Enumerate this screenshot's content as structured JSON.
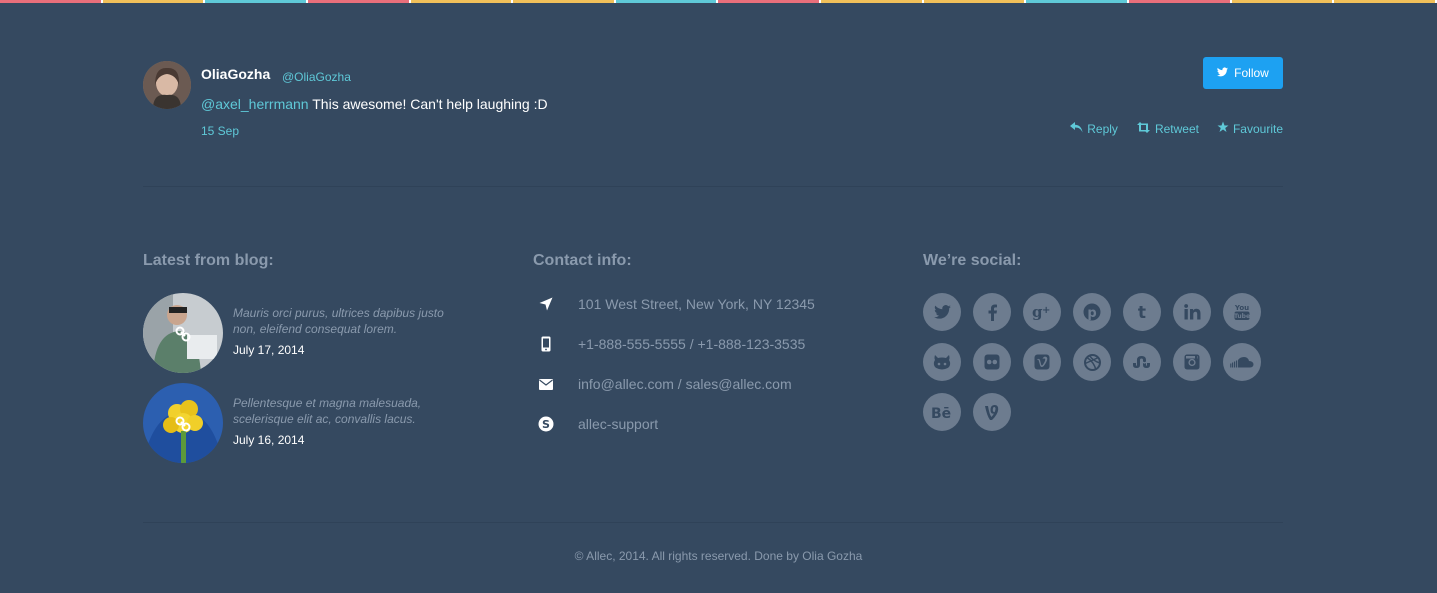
{
  "tweet": {
    "name": "OliaGozha",
    "handle": "@OliaGozha",
    "mention": "@axel_herrmann",
    "text": " This awesome! Can't help laughing :D",
    "date": "15 Sep",
    "follow_label": "Follow",
    "actions": {
      "reply": "Reply",
      "retweet": "Retweet",
      "favourite": "Favourite"
    }
  },
  "blog": {
    "title": "Latest from blog:",
    "posts": [
      {
        "excerpt": "Mauris orci purus, ultrices dapibus justo non, eleifend consequat lorem.",
        "date": "July 17, 2014"
      },
      {
        "excerpt": "Pellentesque et magna malesuada, scelerisque elit ac, convallis lacus.",
        "date": "July 16, 2014"
      }
    ]
  },
  "contact": {
    "title": "Contact info:",
    "items": [
      {
        "icon": "location-arrow-icon",
        "text": "101 West Street, New York, NY 12345"
      },
      {
        "icon": "mobile-phone-icon",
        "text": "+1-888-555-5555 / +1-888-123-3535"
      },
      {
        "icon": "envelope-icon",
        "text": "info@allec.com / sales@allec.com"
      },
      {
        "icon": "skype-icon",
        "text": "allec-support"
      }
    ]
  },
  "social": {
    "title": "We’re social:",
    "icons": [
      "twitter",
      "facebook",
      "google-plus",
      "pinterest",
      "tumblr",
      "linkedin",
      "youtube",
      "github",
      "flickr",
      "vimeo",
      "dribbble",
      "stumbleupon",
      "instagram",
      "soundcloud",
      "behance",
      "vine"
    ]
  },
  "footer": {
    "copyright": "© Allec, 2014. All rights reserved. Done by Olia Gozha"
  },
  "colors": {
    "background": "#354960",
    "accent": "#5fc9d8",
    "follow_button": "#1da1f2",
    "muted_text": "#8a9aad",
    "social_circle": "#6d7c8f"
  }
}
